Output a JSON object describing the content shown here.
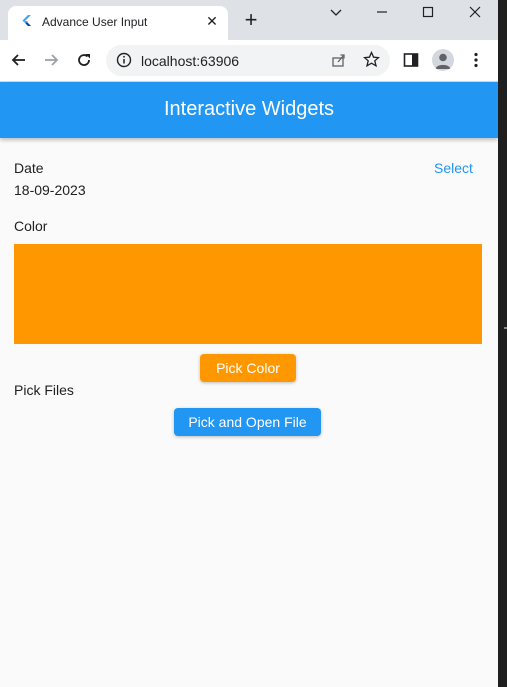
{
  "browser": {
    "tab_title": "Advance User Input",
    "url": "localhost:63906"
  },
  "app": {
    "title": "Interactive Widgets",
    "primary_color": "#2196f3"
  },
  "date_section": {
    "label": "Date",
    "value": "18-09-2023",
    "select_label": "Select"
  },
  "color_section": {
    "label": "Color",
    "swatch_color": "#ff9800",
    "pick_button_label": "Pick Color"
  },
  "files_section": {
    "label": "Pick Files",
    "pick_button_label": "Pick and Open File"
  }
}
